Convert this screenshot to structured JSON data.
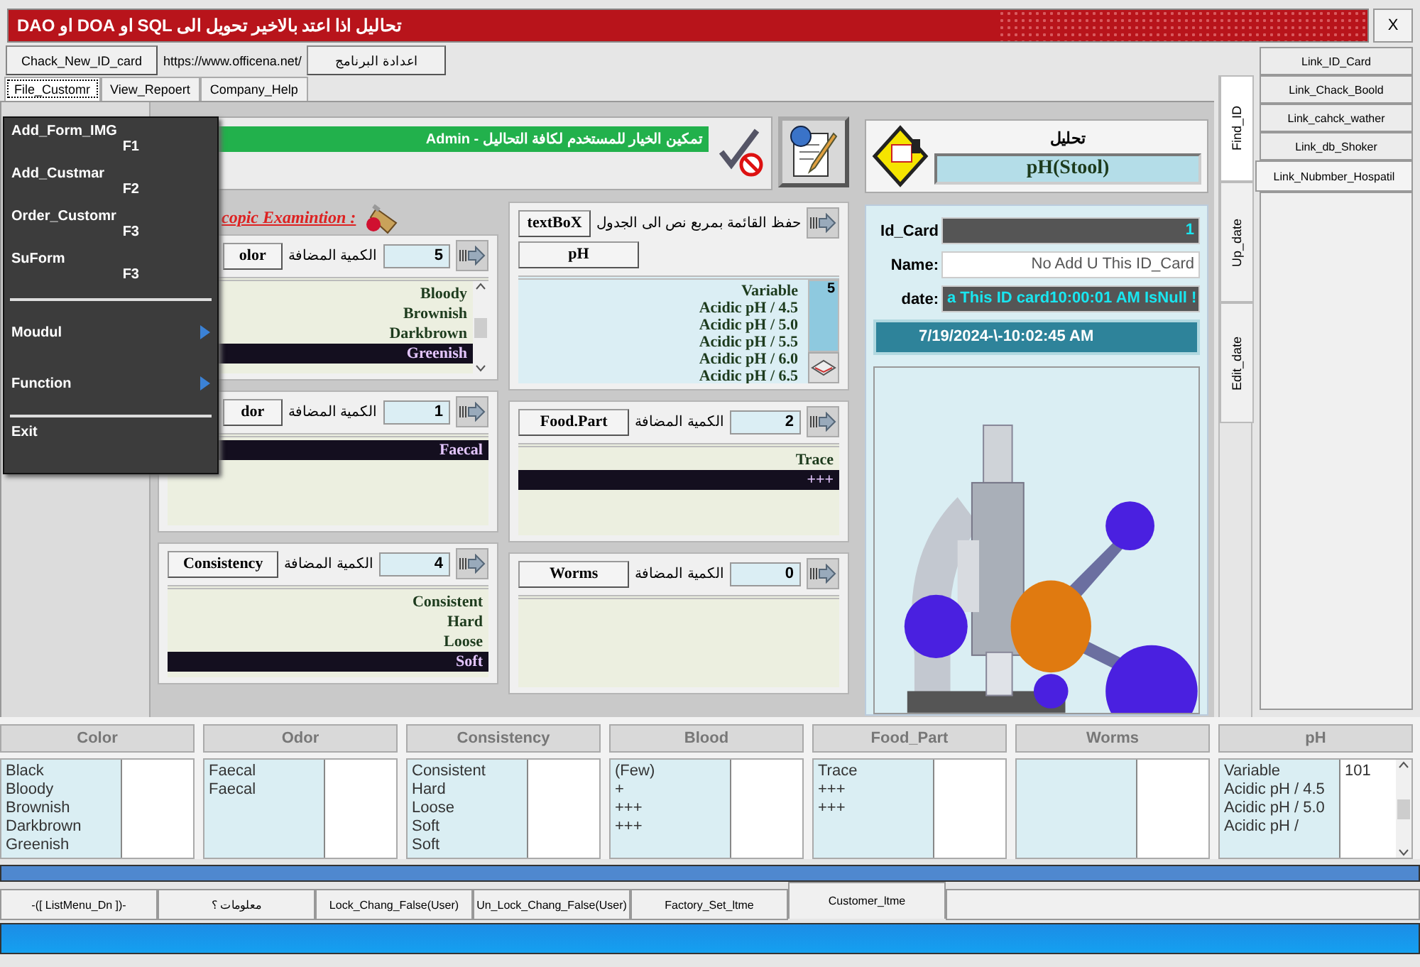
{
  "title_bar": {
    "title": "تحاليل اذا اعتد بالاخير تحويل الى SQL او DOA او DAO",
    "close": "X"
  },
  "toolbar": [
    {
      "kind": "button",
      "label": "Chack_New_ID_card"
    },
    {
      "kind": "link",
      "label": "https://www.officena.net/"
    },
    {
      "kind": "button",
      "label": "اعدادة البرنامج"
    }
  ],
  "tabs": [
    {
      "label": "File_Customr",
      "selected": true
    },
    {
      "label": "View_Repoert",
      "selected": false
    },
    {
      "label": "Company_Help",
      "selected": false
    }
  ],
  "menu": [
    {
      "kind": "item",
      "label": "Add_Form_IMG",
      "shortcut": "F1"
    },
    {
      "kind": "item",
      "label": "Add_Custmar",
      "shortcut": "F2"
    },
    {
      "kind": "item",
      "label": "Order_Customr",
      "shortcut": "F3"
    },
    {
      "kind": "item",
      "label": "SuForm",
      "shortcut": "F3"
    },
    {
      "kind": "separator"
    },
    {
      "kind": "submenu",
      "label": "Moudul"
    },
    {
      "kind": "submenu",
      "label": "Function"
    },
    {
      "kind": "separator"
    },
    {
      "kind": "item",
      "label": "Exit"
    }
  ],
  "banner": {
    "text": "تمكين الخيار للمستخدم لكافة التحاليل - Admin"
  },
  "exam_title": "copic Examintion :",
  "left_panels": [
    {
      "kind": "quantity",
      "name": "olor",
      "covered": true,
      "quantity_label": "الكمية المضافة",
      "quantity": "5",
      "scrollbar": true,
      "items": [
        {
          "text": "Bloody",
          "selected": false
        },
        {
          "text": "Brownish",
          "selected": false
        },
        {
          "text": "Darkbrown",
          "selected": false
        },
        {
          "text": "Greenish",
          "selected": true
        }
      ]
    },
    {
      "kind": "quantity",
      "name": "dor",
      "covered": true,
      "quantity_label": "الكمية المضافة",
      "quantity": "1",
      "items": [
        {
          "text": "Faecal",
          "selected": true
        }
      ]
    },
    {
      "kind": "quantity",
      "name": "Consistency",
      "covered": false,
      "quantity_label": "الكمية المضافة",
      "quantity": "4",
      "items": [
        {
          "text": "Consistent",
          "selected": false
        },
        {
          "text": "Hard",
          "selected": false
        },
        {
          "text": "Loose",
          "selected": false
        },
        {
          "text": "Soft",
          "selected": true
        }
      ]
    }
  ],
  "middle_panels": [
    {
      "kind": "textbox",
      "button": "textBoX",
      "label": "حفظ القائمة بمربع نص الى الجدول",
      "name": "pH",
      "count": "5",
      "items": [
        {
          "text": "Variable",
          "selected": false
        },
        {
          "text": "Acidic pH / 4.5",
          "selected": false
        },
        {
          "text": "Acidic pH / 5.0",
          "selected": false
        },
        {
          "text": "Acidic pH / 5.5",
          "selected": false
        },
        {
          "text": "Acidic pH / 6.0",
          "selected": false
        },
        {
          "text": "Acidic pH / 6.5",
          "selected": false
        }
      ]
    },
    {
      "kind": "quantity",
      "name": "Food.Part",
      "quantity_label": "الكمية المضافة",
      "quantity": "2",
      "items": [
        {
          "text": "Trace",
          "selected": false
        },
        {
          "text": "+++",
          "selected": true
        }
      ]
    },
    {
      "kind": "quantity",
      "name": "Worms",
      "quantity_label": "الكمية المضافة",
      "quantity": "0"
    }
  ],
  "analysis": {
    "heading": "تحليل",
    "test": "pH(Stool)",
    "fields": [
      {
        "label": "Id_Card",
        "value": "1",
        "kind": "dark"
      },
      {
        "label": "Name:",
        "value": "No Add U This ID_Card",
        "kind": "light"
      },
      {
        "label": "date:",
        "value": "a This ID card10:00:01 AM IsNull !",
        "kind": "dark"
      }
    ],
    "timestamp": "7/19/2024-\\-10:02:45 AM"
  },
  "side_tabs": [
    {
      "label": "Find_ID",
      "selected": true
    },
    {
      "label": "Up_date",
      "selected": false
    },
    {
      "label": "Edit_date",
      "selected": false
    }
  ],
  "links": [
    {
      "label": "Link_ID_Card",
      "selected": false
    },
    {
      "label": "Link_Chack_Boold",
      "selected": false
    },
    {
      "label": "Link_cahck_wather",
      "selected": false
    },
    {
      "label": "Link_db_Shoker",
      "selected": false
    },
    {
      "label": "Link_Nubmber_Hospatil",
      "selected": true
    }
  ],
  "summary": [
    {
      "header": "Color",
      "items": [
        "Black",
        "Bloody",
        "Brownish",
        "Darkbrown",
        "Greenish"
      ]
    },
    {
      "header": "Odor",
      "items": [
        "Faecal",
        "Faecal"
      ]
    },
    {
      "header": "Consistency",
      "items": [
        "Consistent",
        "Hard",
        "Loose",
        "Soft",
        "Soft"
      ]
    },
    {
      "header": "Blood",
      "items": [
        "(Few)",
        "+",
        "+++",
        "+++"
      ]
    },
    {
      "header": "Food_Part",
      "items": [
        "Trace",
        "+++",
        "+++"
      ]
    },
    {
      "header": "Worms"
    },
    {
      "header": "pH",
      "items": [
        "Variable",
        "Acidic pH / 4.5",
        "Acidic pH / 5.0",
        "Acidic pH /"
      ],
      "value": "101",
      "scrollbar": true
    }
  ],
  "footer_tabs": [
    {
      "label": "-([ ListMenu_Dn ])-",
      "selected": false
    },
    {
      "label": "معلومات ؟",
      "selected": false
    },
    {
      "label": "Lock_Chang_False(User)",
      "selected": false
    },
    {
      "label": "Un_Lock_Chang_False(User)",
      "selected": false
    },
    {
      "label": "Factory_Set_ltme",
      "selected": false
    },
    {
      "label": "Customer_ltme",
      "selected": true
    }
  ]
}
